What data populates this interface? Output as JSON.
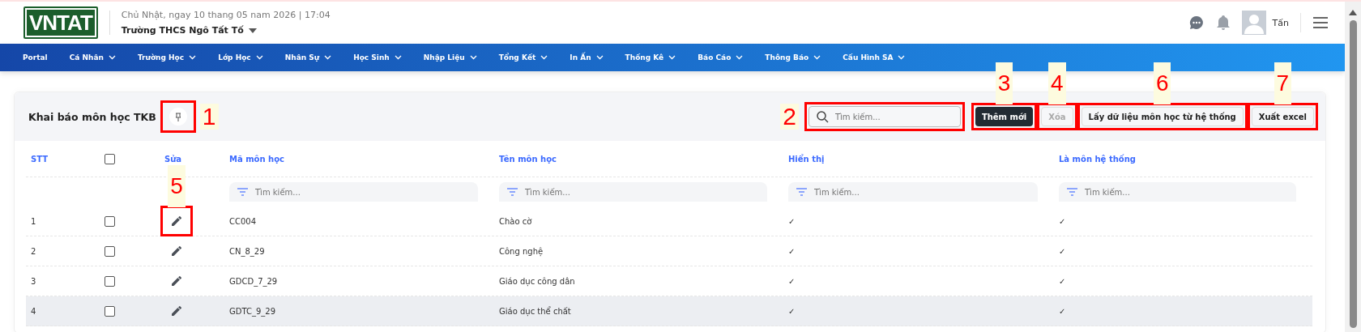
{
  "header": {
    "logo": "VNTAT",
    "date": "Chủ Nhật, ngay 10 thang 05 nam 2026 | 17:04",
    "school": "Trường THCS Ngô Tất Tố",
    "user": "Tấn"
  },
  "nav": [
    {
      "label": "Portal",
      "dropdown": false
    },
    {
      "label": "Cá Nhân",
      "dropdown": true
    },
    {
      "label": "Trường Học",
      "dropdown": true
    },
    {
      "label": "Lớp Học",
      "dropdown": true
    },
    {
      "label": "Nhân Sự",
      "dropdown": true
    },
    {
      "label": "Học Sinh",
      "dropdown": true
    },
    {
      "label": "Nhập Liệu",
      "dropdown": true
    },
    {
      "label": "Tổng Kết",
      "dropdown": true
    },
    {
      "label": "In Ấn",
      "dropdown": true
    },
    {
      "label": "Thống Kê",
      "dropdown": true
    },
    {
      "label": "Báo Cáo",
      "dropdown": true
    },
    {
      "label": "Thông Báo",
      "dropdown": true
    },
    {
      "label": "Cấu Hình SA",
      "dropdown": true
    }
  ],
  "card": {
    "title": "Khai báo môn học TKB",
    "pin_callout": "1",
    "search": {
      "placeholder": "Tìm kiếm...",
      "callout": "2"
    },
    "buttons": [
      {
        "label": "Thêm mới",
        "kind": "primary",
        "disabled": false,
        "callout": "3"
      },
      {
        "label": "Xóa",
        "kind": "default",
        "disabled": true,
        "callout": "4"
      },
      {
        "label": "Lấy dữ liệu môn học từ hệ thống",
        "kind": "default",
        "disabled": false,
        "callout": "6"
      },
      {
        "label": "Xuất excel",
        "kind": "default",
        "disabled": false,
        "callout": "7"
      }
    ]
  },
  "table": {
    "columns": [
      {
        "label": "STT",
        "kind": "text"
      },
      {
        "kind": "checkbox"
      },
      {
        "label": "Sửa",
        "kind": "edit"
      },
      {
        "label": "Mã môn học",
        "kind": "text",
        "placeholder": "Tìm kiếm..."
      },
      {
        "label": "Tên môn học",
        "kind": "text",
        "placeholder": "Tìm kiếm..."
      },
      {
        "label": "Hiển thị",
        "kind": "text",
        "placeholder": "Tìm kiếm..."
      },
      {
        "label": "Là môn hệ thống",
        "kind": "text",
        "placeholder": "Tìm kiếm..."
      }
    ],
    "header_checked": false,
    "rows": [
      {
        "stt": "1",
        "checked": false,
        "code": "CC004",
        "name": "Chào cờ",
        "shown": "✓",
        "system": "✓",
        "highlighted": false,
        "edit_callout": "5"
      },
      {
        "stt": "2",
        "checked": false,
        "code": "CN_8_29",
        "name": "Công nghệ",
        "shown": "✓",
        "system": "✓",
        "highlighted": false,
        "edit_callout": null
      },
      {
        "stt": "3",
        "checked": false,
        "code": "GDCD_7_29",
        "name": "Giáo dục công dân",
        "shown": "✓",
        "system": "✓",
        "highlighted": false,
        "edit_callout": null
      },
      {
        "stt": "4",
        "checked": false,
        "code": "GDTC_9_29",
        "name": "Giáo dục thể chất",
        "shown": "✓",
        "system": "✓",
        "highlighted": true,
        "edit_callout": null
      }
    ]
  }
}
